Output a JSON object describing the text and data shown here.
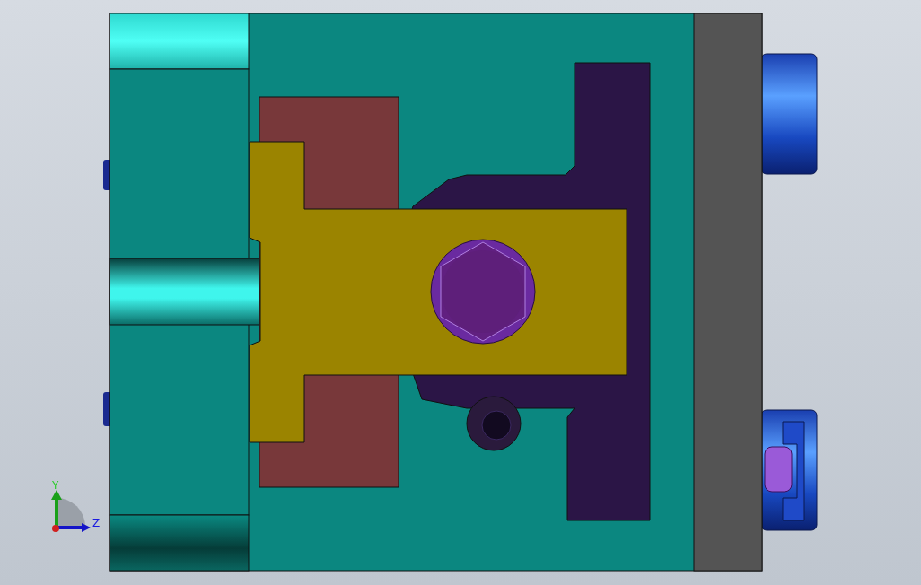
{
  "viewport": {
    "triad": {
      "axes": [
        {
          "kind": "vertical",
          "label": "Y"
        },
        {
          "kind": "horizontal",
          "label": "Z"
        }
      ]
    }
  }
}
